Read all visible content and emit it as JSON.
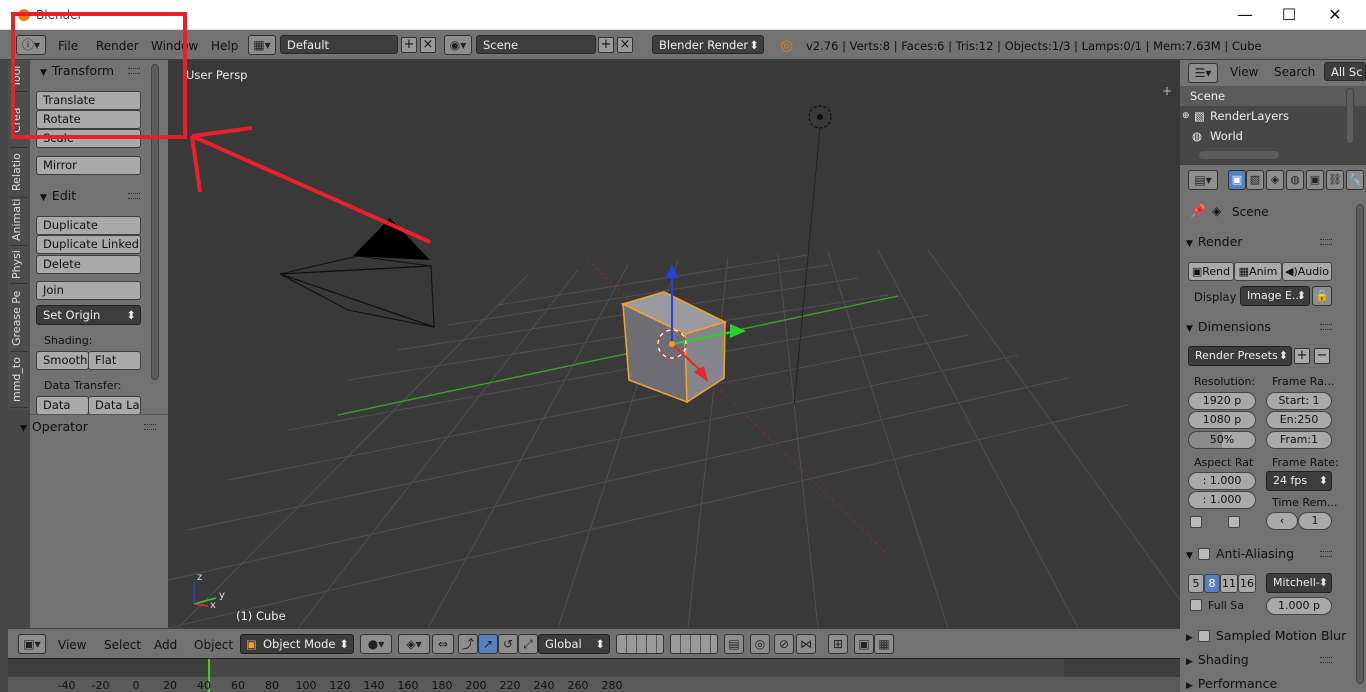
{
  "window": {
    "title": "Blender",
    "minimize": "—",
    "maximize": "☐",
    "close": "✕"
  },
  "menu": {
    "file": "File",
    "render": "Render",
    "window": "Window",
    "help": "Help"
  },
  "layout": {
    "value": "Default"
  },
  "scene": {
    "value": "Scene"
  },
  "engine": {
    "value": "Blender Render"
  },
  "info": {
    "stats": "v2.76 | Verts:8 | Faces:6 | Tris:12 | Objects:1/3 | Lamps:0/1 | Mem:7.63M | Cube"
  },
  "vtabs": [
    "Tool",
    "Crea",
    "Relatio",
    "Animati",
    "Physi",
    "Grease Pe",
    "mmd_to"
  ],
  "shelf": {
    "transform_title": "Transform",
    "translate": "Translate",
    "rotate": "Rotate",
    "scale": "Scale",
    "mirror": "Mirror",
    "edit_title": "Edit",
    "duplicate": "Duplicate",
    "duplicate_linked": "Duplicate Linked",
    "delete": "Delete",
    "join": "Join",
    "set_origin": "Set Origin",
    "shading_label": "Shading:",
    "smooth": "Smooth",
    "flat": "Flat",
    "data_transfer_label": "Data Transfer:",
    "data": "Data",
    "data_la": "Data La",
    "operator_title": "Operator"
  },
  "viewport": {
    "view_label": "User Persp",
    "object_label": "(1) Cube",
    "axis_x": "x",
    "axis_y": "y",
    "axis_z": "z"
  },
  "bottom_header": {
    "view": "View",
    "select": "Select",
    "add": "Add",
    "object": "Object",
    "mode": "Object Mode",
    "orientation": "Global"
  },
  "timeline": {
    "ticks": [
      "-40",
      "-20",
      "0",
      "20",
      "40",
      "60",
      "80",
      "100",
      "120",
      "140",
      "160",
      "180",
      "200",
      "220",
      "240",
      "260",
      "280"
    ]
  },
  "outliner": {
    "view": "View",
    "search": "Search",
    "all_scenes": "All Sc",
    "rows": [
      "Scene",
      "RenderLayers",
      "World"
    ]
  },
  "properties": {
    "context": "Scene",
    "render_title": "Render",
    "render_btn": "Rend",
    "anim_btn": "Anim",
    "audio_btn": "Audio",
    "display_label": "Display",
    "display_value": "Image E...",
    "dimensions_title": "Dimensions",
    "render_presets": "Render Presets",
    "resolution_label": "Resolution:",
    "res_x": "1920 p",
    "res_y": "1080 p",
    "res_pct": "50%",
    "frame_range_label": "Frame Ra...",
    "start": "Start: 1",
    "end": "En:250",
    "frame": "Fram:1",
    "aspect_label": "Aspect Rat",
    "aspect_x": ": 1.000",
    "aspect_y": ": 1.000",
    "frame_rate_label": "Frame Rate:",
    "fps": "24 fps",
    "time_remap_label": "Time Rem...",
    "time_remap_val": "1",
    "aa_title": "Anti-Aliasing",
    "aa_samples": [
      "5",
      "8",
      "11",
      "16"
    ],
    "aa_filter": "Mitchell-",
    "full_sample": "Full Sa",
    "filter_size": "1.000 p",
    "smb_title": "Sampled Motion Blur",
    "shading_title": "Shading",
    "performance_title": "Performance"
  },
  "colors": {
    "accent_orange": "#e87d0d",
    "selection": "#5680c2",
    "annotation_red": "#e8202a"
  }
}
